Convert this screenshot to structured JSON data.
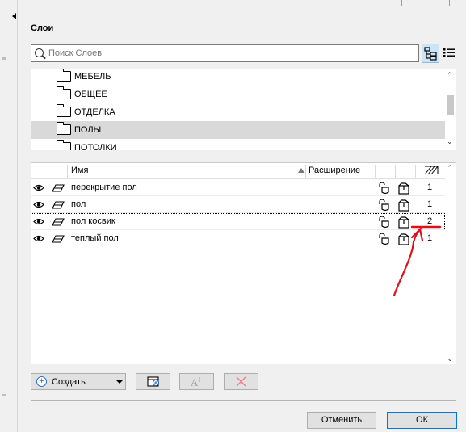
{
  "panel": {
    "title": "Слои",
    "search": {
      "placeholder": "Поиск Слоев",
      "value": ""
    }
  },
  "folders": [
    {
      "label": "МЕБЕЛЬ",
      "selected": false
    },
    {
      "label": "ОБЩЕЕ",
      "selected": false
    },
    {
      "label": "ОТДЕЛКА",
      "selected": false
    },
    {
      "label": "ПОЛЫ",
      "selected": true
    },
    {
      "label": "ПОТОЛКИ",
      "selected": false
    }
  ],
  "table": {
    "headers": {
      "name": "Имя",
      "extension": "Расширение"
    },
    "rows": [
      {
        "name": "перекрытие пол",
        "pen": "1"
      },
      {
        "name": "пол",
        "pen": "1"
      },
      {
        "name": "пол косвик",
        "pen": "2"
      },
      {
        "name": "теплый пол",
        "pen": "1"
      }
    ]
  },
  "toolbar": {
    "create_label": "Создать"
  },
  "buttons": {
    "cancel": "Отменить",
    "ok": "ОК"
  },
  "colors": {
    "selection": "#d9d9d9",
    "focus_blue": "#0078d7",
    "annotation_red": "#e0101a",
    "create_icon_blue": "#2a6cc7"
  }
}
